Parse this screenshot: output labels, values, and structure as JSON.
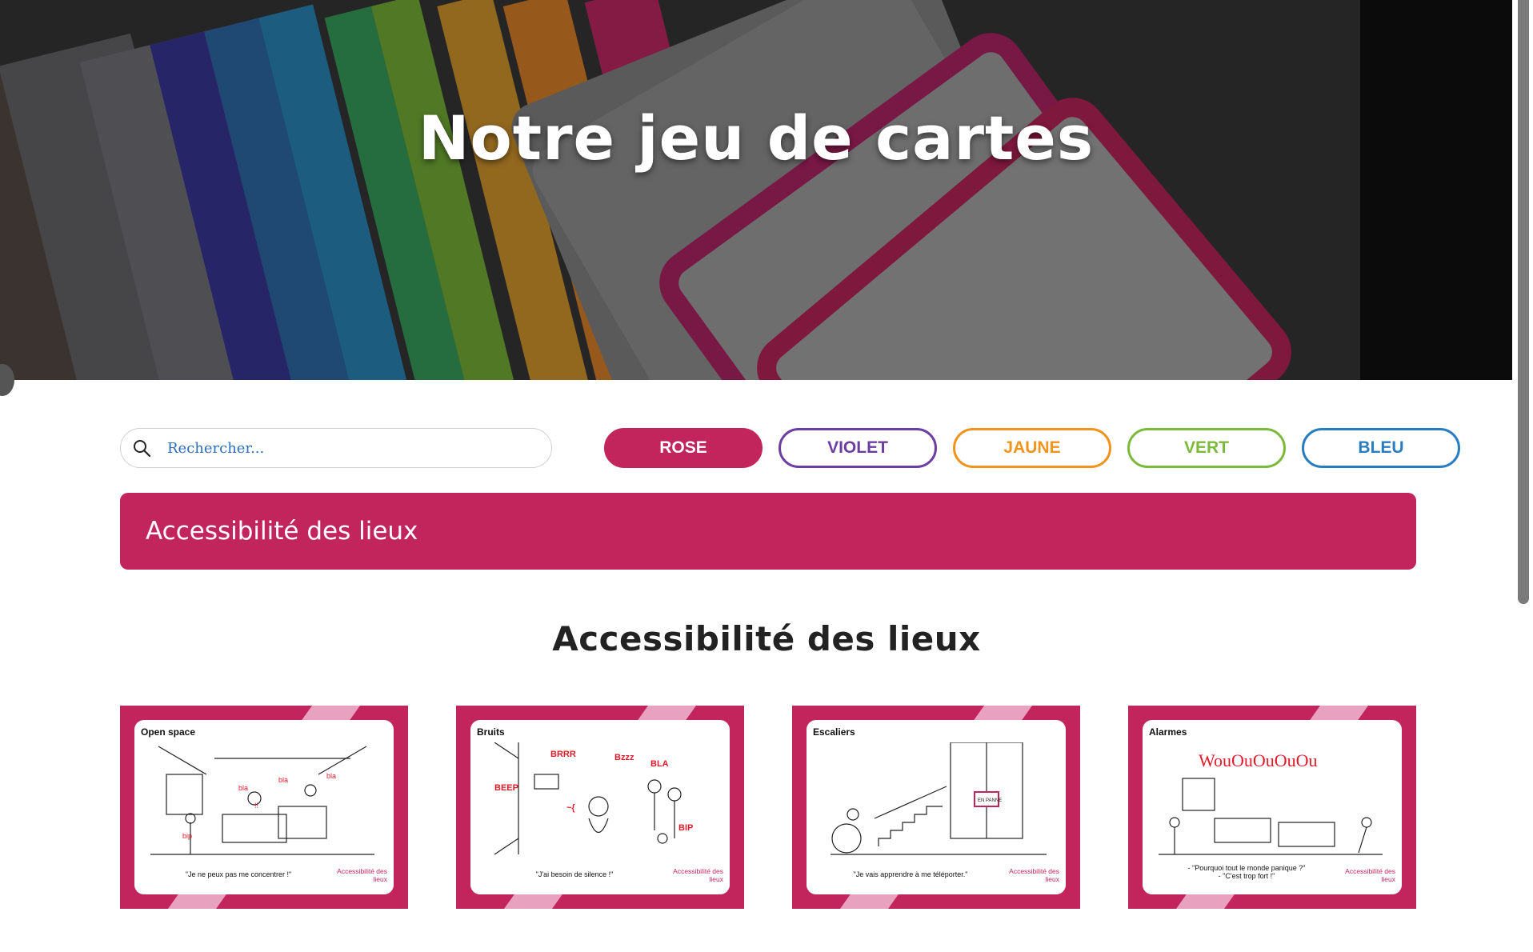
{
  "hero": {
    "title": "Notre jeu de cartes"
  },
  "search": {
    "placeholder": "Rechercher..."
  },
  "filters": [
    {
      "label": "ROSE",
      "color": "#c2255c",
      "active": true
    },
    {
      "label": "VIOLET",
      "color": "#6b3fa0",
      "active": false
    },
    {
      "label": "JAUNE",
      "color": "#f0941d",
      "active": false
    },
    {
      "label": "VERT",
      "color": "#7cba3b",
      "active": false
    },
    {
      "label": "BLEU",
      "color": "#2a7cc1",
      "active": false
    }
  ],
  "category_bar": {
    "label": "Accessibilité des lieux",
    "color": "#c2255c"
  },
  "section": {
    "title": "Accessibilité des lieux"
  },
  "cards": [
    {
      "name": "Open space",
      "quote": "\"Je ne peux pas me concentrer !\"",
      "category": "Accessibilité des lieux"
    },
    {
      "name": "Bruits",
      "quote": "\"J'ai besoin de silence !\"",
      "category": "Accessibilité des lieux"
    },
    {
      "name": "Escaliers",
      "quote": "\"Je vais apprendre à me téléporter.\"",
      "category": "Accessibilité des lieux"
    },
    {
      "name": "Alarmes",
      "quote": "- \"Pourquoi tout le monde panique ?\"\n- \"C'est trop fort !\"",
      "category": "Accessibilité des lieux"
    }
  ],
  "colors": {
    "rose": "#c2255c",
    "rose_light": "#e8a2bf"
  }
}
